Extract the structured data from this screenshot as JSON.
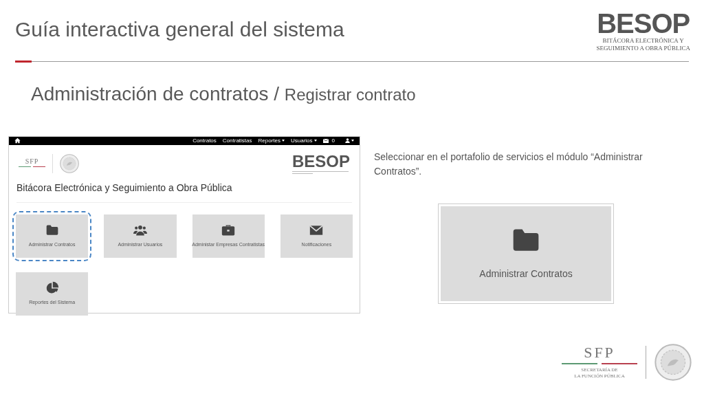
{
  "slide": {
    "title": "Guía interactiva general del sistema",
    "section": "Administración de contratos",
    "separator": "/",
    "step": "Registrar contrato"
  },
  "header_logo": {
    "name": "BESOP",
    "lines": [
      "BITÁCORA ELECTRÓNICA Y",
      "SEGUIMIENTO A OBRA PÚBLICA"
    ]
  },
  "app_screenshot": {
    "navbar": {
      "links": [
        {
          "label": "Contratos",
          "dropdown": false
        },
        {
          "label": "Contratistas",
          "dropdown": false
        },
        {
          "label": "Reportes",
          "dropdown": true
        },
        {
          "label": "Usuarios",
          "dropdown": true
        }
      ],
      "messages_count": "0"
    },
    "sfp_logo": {
      "name": "SFP"
    },
    "besop_logo": {
      "name": "BESOP"
    },
    "system_title": "Bitácora Electrónica y Seguimiento a Obra Pública",
    "modules": [
      {
        "label": "Administrar Contratos",
        "kind": "folder",
        "selected": true
      },
      {
        "label": "Administrar Usuarios",
        "kind": "users",
        "selected": false
      },
      {
        "label": "Administar Empresas Contratistas",
        "kind": "briefcase",
        "selected": false
      },
      {
        "label": "Notificaciones",
        "kind": "envelope",
        "selected": false
      },
      {
        "label": "Reportes del Sistema",
        "kind": "piechart",
        "selected": false
      }
    ]
  },
  "instruction": "Seleccionar en el portafolio de servicios el módulo “Administrar Contratos”.",
  "zoomed_module": {
    "label": "Administrar Contratos",
    "kind": "folder"
  },
  "footer_logo": {
    "name": "SFP",
    "lines": [
      "SECRETARÍA DE",
      "LA FUNCIÓN PÚBLICA"
    ]
  }
}
